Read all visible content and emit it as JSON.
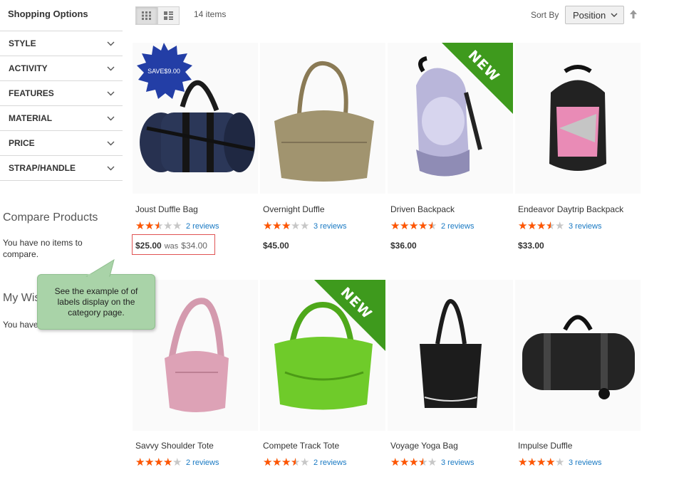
{
  "sidebar": {
    "title": "Shopping Options",
    "filters": [
      {
        "label": "STYLE"
      },
      {
        "label": "ACTIVITY"
      },
      {
        "label": "FEATURES"
      },
      {
        "label": "MATERIAL"
      },
      {
        "label": "PRICE"
      },
      {
        "label": "STRAP/HANDLE"
      }
    ],
    "compare": {
      "title": "Compare Products",
      "text": "You have no items to compare."
    },
    "wishlist": {
      "title": "My Wis",
      "text": "You have wish list."
    }
  },
  "callout": {
    "text": "See the example of of labels display on the category page."
  },
  "toolbar": {
    "amount": "14 items",
    "sort_label": "Sort By",
    "sort_value": "Position"
  },
  "products": [
    {
      "name": "Joust Duffle Bag",
      "rating": 0.5,
      "reviews": "2 reviews",
      "price": "$25.00",
      "was_label": "was",
      "old_price": "$34.00",
      "label": "SAVE$9.00",
      "label_type": "save",
      "color": "#2a3550"
    },
    {
      "name": "Overnight Duffle",
      "rating": 0.6,
      "reviews": "3 reviews",
      "price": "$45.00",
      "color": "#9b8d6c"
    },
    {
      "name": "Driven Backpack",
      "rating": 0.9,
      "reviews": "2 reviews",
      "price": "$36.00",
      "label": "NEW",
      "label_type": "new",
      "color": "#b7b4d8"
    },
    {
      "name": "Endeavor Daytrip Backpack",
      "rating": 0.7,
      "reviews": "3 reviews",
      "price": "$33.00",
      "color": "#e98bb6"
    },
    {
      "name": "Savvy Shoulder Tote",
      "rating": 0.8,
      "reviews": "2 reviews",
      "color": "#dda2b6"
    },
    {
      "name": "Compete Track Tote",
      "rating": 0.7,
      "reviews": "2 reviews",
      "label": "NEW",
      "label_type": "new",
      "color": "#6fcb2a"
    },
    {
      "name": "Voyage Yoga Bag",
      "rating": 0.7,
      "reviews": "3 reviews",
      "color": "#1c1c1c"
    },
    {
      "name": "Impulse Duffle",
      "rating": 0.8,
      "reviews": "3 reviews",
      "color": "#242424"
    }
  ],
  "colors": {
    "star": "#ff5501",
    "review_link": "#1979c3",
    "new_ribbon": "#3e9a1d",
    "save_badge": "#233ea6",
    "callout": "#a9d3a8"
  }
}
